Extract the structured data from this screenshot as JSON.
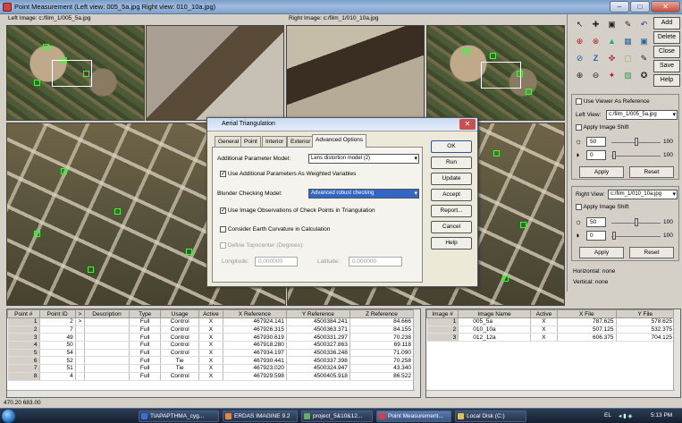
{
  "window": {
    "title": "Point Measurement (Left view: 005_5a.jpg  Right view: 010_10a.jpg)",
    "minimize": "–",
    "maximize": "□",
    "close": "✕"
  },
  "viewer": {
    "left_label": "Left Image: c:/film_1/005_5a.jpg",
    "right_label": "Right Image: c:/film_1/010_10a.jpg"
  },
  "side_buttons": [
    "Add",
    "Delete",
    "Close",
    "Save",
    "Help"
  ],
  "tools": [
    "↖",
    "✚",
    "▣",
    "✎",
    "↶",
    "⊕",
    "⊗",
    "▲",
    "▦",
    "▣",
    "⊘",
    "Z",
    "✜",
    "▢",
    "✎",
    "⊕",
    "⊖",
    "✦",
    "▧",
    "✪"
  ],
  "left_view_panel": {
    "use_viewer_as_reference": "Use Viewer As Reference",
    "left_view_label": "Left View:",
    "left_view_value": "c:/film_1/005_5a.jpg",
    "apply_image_shift": "Apply Image Shift",
    "brightness_value": "50",
    "contrast_value": "0",
    "slider_max": "100",
    "apply": "Apply",
    "reset": "Reset"
  },
  "right_view_panel": {
    "right_view_label": "Right View:",
    "right_view_value": "c:/film_1/010_10a.jpg",
    "apply_image_shift": "Apply Image Shift",
    "brightness_value": "50",
    "contrast_value": "0",
    "slider_max": "100",
    "apply": "Apply",
    "reset": "Reset"
  },
  "status": {
    "horizontal": "Horizontal: none",
    "vertical": "Vertical: none"
  },
  "dialog": {
    "title": "Aerial Triangulation",
    "close": "✕",
    "tabs": [
      "General",
      "Point",
      "Interior",
      "Exterior",
      "Advanced Options"
    ],
    "additional_parameter_model_label": "Additional Parameter Model:",
    "additional_parameter_model_value": "Lens distortion model (2)",
    "use_additional_params": "Use Additional Parameters As Weighted Variables",
    "blunder_checking_label": "Blunder Checking Model:",
    "blunder_checking_value": "Advanced robust checking",
    "use_image_observations": "Use Image Observations of Check Points in Triangulation",
    "earth_curvature": "Consider Earth Curvature in Calculation",
    "define_topocenter": "Define Topocenter (Degrees):",
    "longitude_label": "Longitude:",
    "longitude_value": "0.000000",
    "latitude_label": "Latitude:",
    "latitude_value": "0.000000",
    "buttons": [
      "OK",
      "Run",
      "Update",
      "Accept",
      "Report...",
      "Cancel",
      "Help"
    ]
  },
  "points_table": {
    "headers": [
      "Point #",
      "Point ID",
      ">",
      "Description",
      "Type",
      "Usage",
      "Active",
      "X Reference",
      "Y Reference",
      "Z Reference"
    ],
    "rows": [
      [
        "1",
        "2",
        ">",
        "",
        "Full",
        "Control",
        "X",
        "467924.141",
        "4500384.241",
        "84.666"
      ],
      [
        "2",
        "7",
        "",
        "",
        "Full",
        "Control",
        "X",
        "467926.315",
        "4500363.371",
        "84.155"
      ],
      [
        "3",
        "49",
        "",
        "",
        "Full",
        "Control",
        "X",
        "467930.619",
        "4500331.297",
        "70.238"
      ],
      [
        "4",
        "50",
        "",
        "",
        "Full",
        "Control",
        "X",
        "467918.280",
        "4500327.863",
        "69.118"
      ],
      [
        "5",
        "54",
        "",
        "",
        "Full",
        "Control",
        "X",
        "467934.197",
        "4500336.248",
        "71.090"
      ],
      [
        "6",
        "52",
        "",
        "",
        "Full",
        "Tie",
        "X",
        "467930.441",
        "4500337.398",
        "70.258"
      ],
      [
        "7",
        "51",
        "",
        "",
        "Full",
        "Tie",
        "X",
        "467923.020",
        "4500324.947",
        "43.340"
      ],
      [
        "8",
        "4",
        "",
        "",
        "Full",
        "Control",
        "X",
        "467929.598",
        "4500405.918",
        "86.522"
      ]
    ]
  },
  "images_table": {
    "headers": [
      "Image #",
      "Image Name",
      "Active",
      "X File",
      "Y File"
    ],
    "rows": [
      [
        "1",
        "005_5a",
        "X",
        "787.625",
        "578.625"
      ],
      [
        "2",
        "010_10a",
        "X",
        "507.125",
        "532.375"
      ],
      [
        "3",
        "012_12a",
        "X",
        "606.375",
        "704.125"
      ]
    ]
  },
  "coords_readout": "470.20   683.00",
  "taskbar": {
    "items": [
      "ΤΙΑΡΑΡΤΗΜΑ_cyg...",
      "ERDAS IMAGINE 9.2",
      "project_5&10&12...",
      "Point Measurement...",
      "Local Disk (C:)"
    ],
    "lang": "EL",
    "clock": "5:13 PM"
  }
}
